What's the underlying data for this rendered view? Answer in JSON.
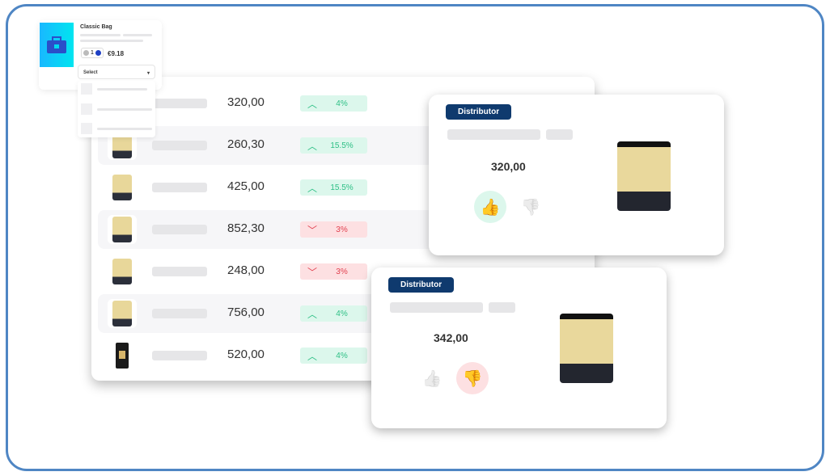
{
  "mini_product": {
    "title": "Classic Bag",
    "quantity": "1",
    "price": "€9.18",
    "select_label": "Select",
    "icon": "briefcase-icon"
  },
  "table": {
    "rows": [
      {
        "image": "pasta",
        "price": "320,00",
        "trend": "up",
        "change": "4%"
      },
      {
        "image": "pasta",
        "price": "260,30",
        "trend": "up",
        "change": "15.5%"
      },
      {
        "image": "pasta",
        "price": "425,00",
        "trend": "up",
        "change": "15.5%"
      },
      {
        "image": "pasta",
        "price": "852,30",
        "trend": "down",
        "change": "3%"
      },
      {
        "image": "pasta",
        "price": "248,00",
        "trend": "down",
        "change": "3%"
      },
      {
        "image": "pasta",
        "price": "756,00",
        "trend": "up",
        "change": "4%"
      },
      {
        "image": "wine",
        "price": "520,00",
        "trend": "up",
        "change": "4%"
      }
    ]
  },
  "cards": [
    {
      "badge": "Distributor",
      "price": "320,00",
      "vote": "up"
    },
    {
      "badge": "Distributor",
      "price": "342,00",
      "vote": "down"
    }
  ],
  "colors": {
    "up": "#2dbf85",
    "down": "#e2404f",
    "badge": "#0f3a6e",
    "frame": "#4f86c4"
  }
}
